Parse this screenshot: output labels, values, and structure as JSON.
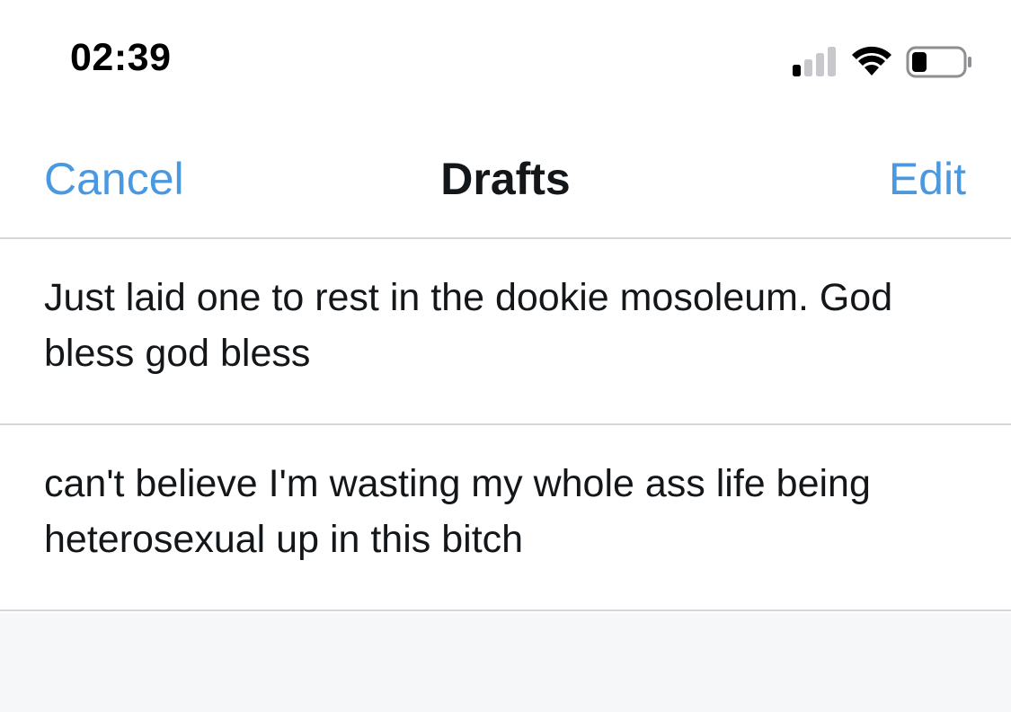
{
  "status_bar": {
    "time": "02:39",
    "icons": [
      "signal-icon",
      "wifi-icon",
      "battery-icon"
    ],
    "battery_level": 0.3,
    "signal_bars_active": 1,
    "signal_bars_total": 4
  },
  "nav": {
    "cancel_label": "Cancel",
    "title": "Drafts",
    "edit_label": "Edit"
  },
  "drafts": [
    {
      "text": "Just laid one to rest in the dookie mosoleum. God bless god bless"
    },
    {
      "text": "can't believe I'm wasting my whole ass life being heterosexual up in this bitch"
    }
  ],
  "colors": {
    "accent": "#4a98df",
    "text": "#14171a",
    "separator": "#d6d6da",
    "footer_background": "#f5f7f9"
  }
}
